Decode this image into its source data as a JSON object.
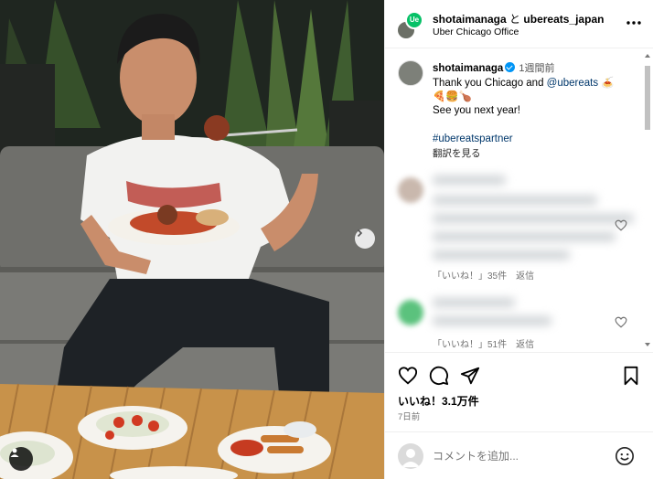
{
  "header": {
    "account_main": "shotaimanaga",
    "connector": "と",
    "account_collab": "ubereats_japan",
    "location": "Uber Chicago Office",
    "brand_color": "#06c167"
  },
  "caption": {
    "username": "shotaimanaga",
    "time": "1週間前",
    "line1_text": "Thank you Chicago and ",
    "line1_mention": "@ubereats",
    "line1_emoji": "🍝",
    "line2_emoji": "🍕🍔🍗",
    "line3": "See you next year!",
    "hashtag": "#ubereatspartner",
    "translate": "翻訳を見る"
  },
  "comments": [
    {
      "likes_label": "「いいね！」35件",
      "reply": "返信"
    },
    {
      "likes_label": "「いいね！」51件",
      "reply": "返信"
    }
  ],
  "post": {
    "likes": "いいね！3.1万件",
    "date": "7日前"
  },
  "comment_input": {
    "placeholder": "コメントを追加..."
  },
  "icons": {
    "like": "heart-icon",
    "comment": "comment-icon",
    "share": "share-icon",
    "save": "bookmark-icon",
    "more": "more-icon",
    "next": "chevron-right-icon",
    "tagged": "user-tag-icon",
    "emoji": "emoji-icon"
  }
}
